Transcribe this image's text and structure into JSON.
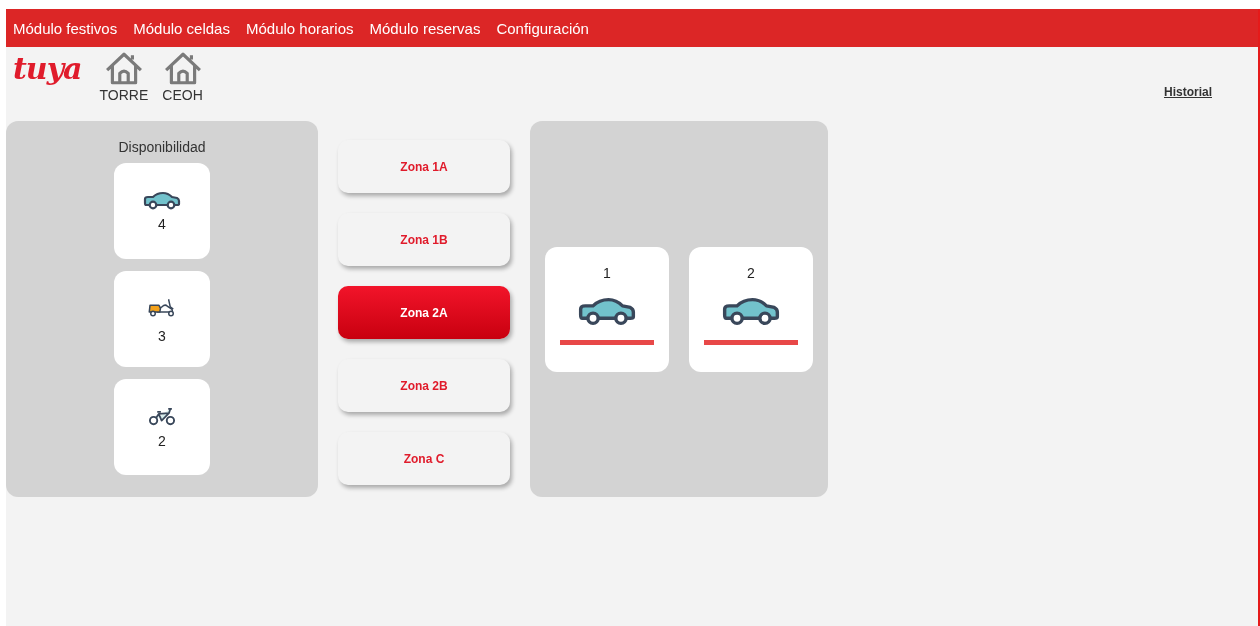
{
  "nav": {
    "items": [
      {
        "label": "Módulo festivos"
      },
      {
        "label": "Módulo celdas"
      },
      {
        "label": "Módulo horarios"
      },
      {
        "label": "Módulo reservas"
      },
      {
        "label": "Configuración"
      }
    ]
  },
  "header": {
    "logo": "tuya",
    "sites": [
      {
        "label": "TORRE"
      },
      {
        "label": "CEOH"
      }
    ],
    "history_link": "Historial"
  },
  "availability": {
    "title": "Disponibilidad",
    "vehicles": [
      {
        "kind": "car",
        "count": "4"
      },
      {
        "kind": "scooter",
        "count": "3"
      },
      {
        "kind": "bike",
        "count": "2"
      }
    ]
  },
  "zones": [
    {
      "label": "Zona 1A",
      "selected": false
    },
    {
      "label": "Zona 1B",
      "selected": false
    },
    {
      "label": "Zona 2A",
      "selected": true
    },
    {
      "label": "Zona 2B",
      "selected": false
    },
    {
      "label": "Zona C",
      "selected": false
    }
  ],
  "cells": [
    {
      "number": "1",
      "kind": "car",
      "color": "#e84848"
    },
    {
      "number": "2",
      "kind": "car",
      "color": "#e84848"
    }
  ]
}
